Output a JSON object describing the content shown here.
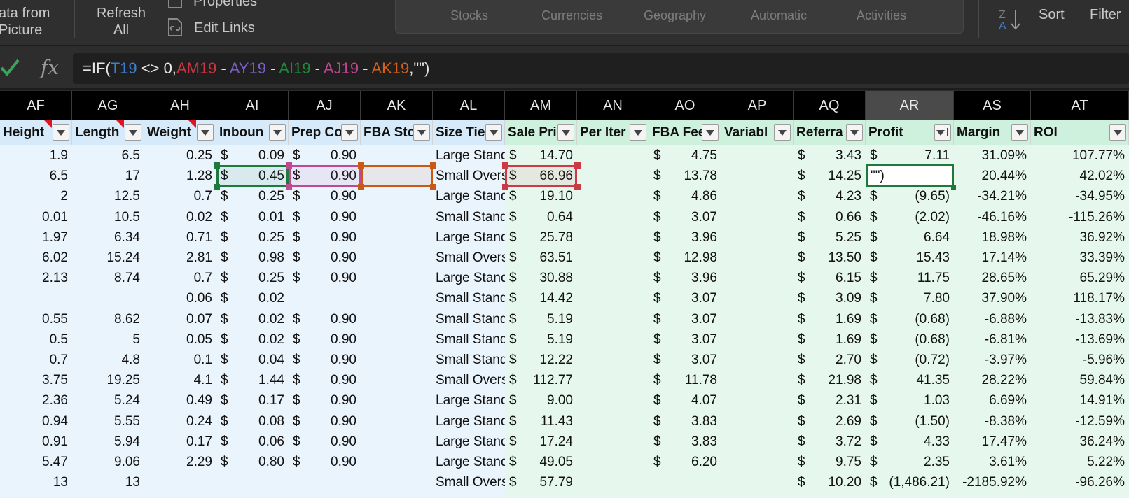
{
  "ribbon": {
    "get_data_line1": "ata from",
    "get_data_line2": "Picture",
    "refresh_line1": "Refresh",
    "refresh_line2": "All",
    "properties": "Properties",
    "edit_links": "Edit Links",
    "data_types": [
      "Stocks",
      "Currencies",
      "Geography",
      "Automatic",
      "Activities"
    ],
    "sort_az_top": "Z",
    "sort_az_bottom": "A",
    "sort": "Sort",
    "filter": "Filter"
  },
  "formula_bar": {
    "fx": "fx",
    "segments": [
      {
        "text": "=IF(",
        "color": "#e6e6e6"
      },
      {
        "text": "T19",
        "color": "#3f7fd0"
      },
      {
        "text": " <> 0,",
        "color": "#e6e6e6"
      },
      {
        "text": "AM19",
        "color": "#d0333f"
      },
      {
        "text": " - ",
        "color": "#e6e6e6"
      },
      {
        "text": "AY19",
        "color": "#7a5fc4"
      },
      {
        "text": " - ",
        "color": "#e6e6e6"
      },
      {
        "text": "AI19",
        "color": "#1f8a3a"
      },
      {
        "text": " - ",
        "color": "#e6e6e6"
      },
      {
        "text": "AJ19",
        "color": "#c0458f"
      },
      {
        "text": " - ",
        "color": "#e6e6e6"
      },
      {
        "text": "AK19",
        "color": "#d0621d"
      },
      {
        "text": ",\"\")",
        "color": "#e6e6e6"
      }
    ]
  },
  "colors": {
    "range_AI": "#1e7a3c",
    "range_AJ": "#c04a92",
    "range_AK": "#c85a16",
    "range_AM": "#cc3a46",
    "active_cell": "#1e7a3c",
    "blue_band": "#eaf4fd",
    "green_band": "#e6f8ee",
    "blue_header": "#d6eafa",
    "green_header": "#cdf1dc"
  },
  "grid": {
    "columns": [
      {
        "letter": "AF",
        "header": "Height",
        "comment": true
      },
      {
        "letter": "AG",
        "header": "Length",
        "comment": true
      },
      {
        "letter": "AH",
        "header": "Weight",
        "comment": true
      },
      {
        "letter": "AI",
        "header": "Inboun",
        "comment": false
      },
      {
        "letter": "AJ",
        "header": "Prep Co",
        "comment": false
      },
      {
        "letter": "AK",
        "header": "FBA Sto",
        "comment": false
      },
      {
        "letter": "AL",
        "header": "Size Tier",
        "comment": false
      },
      {
        "letter": "AM",
        "header": "Sale Pri",
        "comment": false
      },
      {
        "letter": "AN",
        "header": "Per Iter",
        "comment": false
      },
      {
        "letter": "AO",
        "header": "FBA Fee",
        "comment": false
      },
      {
        "letter": "AP",
        "header": "Variabl",
        "comment": false
      },
      {
        "letter": "AQ",
        "header": "Referra",
        "comment": false
      },
      {
        "letter": "AR",
        "header": "Profit",
        "comment": false
      },
      {
        "letter": "AS",
        "header": "Margin",
        "comment": false
      },
      {
        "letter": "AT",
        "header": "ROI",
        "comment": false
      }
    ],
    "active_cell_text": "\"\")",
    "rows": [
      [
        "1.9",
        "6.5",
        "0.25",
        "0.09",
        "0.90",
        "",
        "Large Standard",
        "14.70",
        "",
        "4.75",
        "",
        "3.43",
        "7.11",
        "31.09%",
        "107.77%"
      ],
      [
        "6.5",
        "17",
        "1.28",
        "0.45",
        "0.90",
        "",
        "Small Oversize",
        "66.96",
        "",
        "13.78",
        "",
        "14.25",
        "",
        "20.44%",
        "42.02%"
      ],
      [
        "2",
        "12.5",
        "0.7",
        "0.25",
        "0.90",
        "",
        "Large Standard",
        "19.10",
        "",
        "4.86",
        "",
        "4.23",
        "(9.65)",
        "-34.21%",
        "-34.95%"
      ],
      [
        "0.01",
        "10.5",
        "0.02",
        "0.01",
        "0.90",
        "",
        "Small Standard",
        "0.64",
        "",
        "3.07",
        "",
        "0.66",
        "(2.02)",
        "-46.16%",
        "-115.26%"
      ],
      [
        "1.97",
        "6.34",
        "0.71",
        "0.25",
        "0.90",
        "",
        "Large Standard",
        "25.78",
        "",
        "3.96",
        "",
        "5.25",
        "6.64",
        "18.98%",
        "36.92%"
      ],
      [
        "6.02",
        "15.24",
        "2.81",
        "0.98",
        "0.90",
        "",
        "Small Oversize",
        "63.51",
        "",
        "12.98",
        "",
        "13.50",
        "15.43",
        "17.14%",
        "33.39%"
      ],
      [
        "2.13",
        "8.74",
        "0.7",
        "0.25",
        "0.90",
        "",
        "Large Standard",
        "30.88",
        "",
        "3.96",
        "",
        "6.15",
        "11.75",
        "28.65%",
        "65.29%"
      ],
      [
        "",
        "",
        "0.06",
        "0.02",
        "",
        "",
        "Small Standard",
        "14.42",
        "",
        "3.07",
        "",
        "3.09",
        "7.80",
        "37.90%",
        "118.17%"
      ],
      [
        "0.55",
        "8.62",
        "0.07",
        "0.02",
        "0.90",
        "",
        "Small Standard",
        "5.19",
        "",
        "3.07",
        "",
        "1.69",
        "(0.68)",
        "-6.88%",
        "-13.83%"
      ],
      [
        "0.5",
        "5",
        "0.05",
        "0.02",
        "0.90",
        "",
        "Small Standard",
        "5.19",
        "",
        "3.07",
        "",
        "1.69",
        "(0.68)",
        "-6.81%",
        "-13.69%"
      ],
      [
        "0.7",
        "4.8",
        "0.1",
        "0.04",
        "0.90",
        "",
        "Small Standard",
        "12.22",
        "",
        "3.07",
        "",
        "2.70",
        "(0.72)",
        "-3.97%",
        "-5.96%"
      ],
      [
        "3.75",
        "19.25",
        "4.1",
        "1.44",
        "0.90",
        "",
        "Small Oversize",
        "112.77",
        "",
        "11.78",
        "",
        "21.98",
        "41.35",
        "28.22%",
        "59.84%"
      ],
      [
        "2.36",
        "5.24",
        "0.49",
        "0.17",
        "0.90",
        "",
        "Large Standard",
        "9.00",
        "",
        "4.07",
        "",
        "2.31",
        "1.03",
        "6.69%",
        "14.91%"
      ],
      [
        "0.94",
        "5.55",
        "0.24",
        "0.08",
        "0.90",
        "",
        "Large Standard",
        "11.43",
        "",
        "3.83",
        "",
        "2.69",
        "(1.50)",
        "-8.38%",
        "-12.59%"
      ],
      [
        "0.91",
        "5.94",
        "0.17",
        "0.06",
        "0.90",
        "",
        "Large Standard",
        "17.24",
        "",
        "3.83",
        "",
        "3.72",
        "4.33",
        "17.47%",
        "36.24%"
      ],
      [
        "5.47",
        "9.06",
        "2.29",
        "0.80",
        "0.90",
        "",
        "Large Standard",
        "49.05",
        "",
        "6.20",
        "",
        "9.75",
        "2.35",
        "3.61%",
        "5.22%"
      ],
      [
        "13",
        "13",
        "",
        "",
        "",
        "",
        "Small Oversize",
        "57.79",
        "",
        "",
        "",
        "10.20",
        "(1,486.21)",
        "-2185.92%",
        "-96.26%"
      ]
    ]
  }
}
